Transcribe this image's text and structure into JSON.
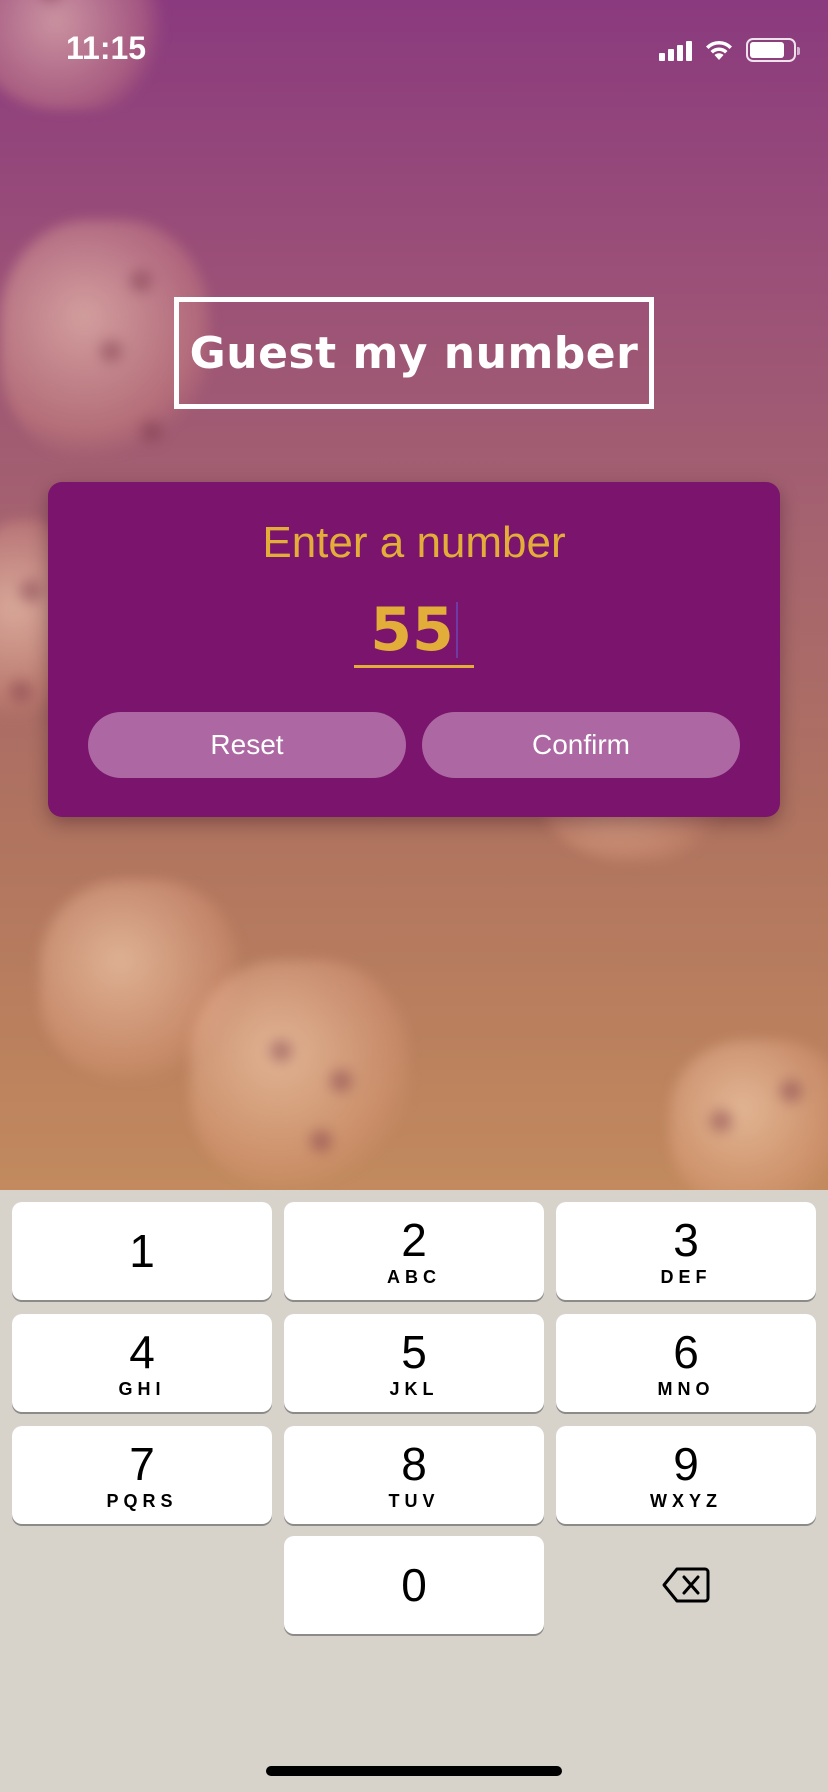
{
  "status_bar": {
    "time": "11:15",
    "icons": [
      "cellular-signal-icon",
      "wifi-icon",
      "battery-icon"
    ]
  },
  "title": "Guest my number",
  "card": {
    "label": "Enter a number",
    "input_value": "55",
    "reset_label": "Reset",
    "confirm_label": "Confirm"
  },
  "keypad": {
    "keys": [
      {
        "digit": "1",
        "letters": ""
      },
      {
        "digit": "2",
        "letters": "ABC"
      },
      {
        "digit": "3",
        "letters": "DEF"
      },
      {
        "digit": "4",
        "letters": "GHI"
      },
      {
        "digit": "5",
        "letters": "JKL"
      },
      {
        "digit": "6",
        "letters": "MNO"
      },
      {
        "digit": "7",
        "letters": "PQRS"
      },
      {
        "digit": "8",
        "letters": "TUV"
      },
      {
        "digit": "9",
        "letters": "WXYZ"
      },
      {
        "digit": "0",
        "letters": ""
      }
    ],
    "backspace_icon": "backspace-icon"
  },
  "colors": {
    "card_background": "#7a146c",
    "accent": "#e3ad3a",
    "button_background": "#ad67a3",
    "keypad_background": "#d7d3cb"
  }
}
